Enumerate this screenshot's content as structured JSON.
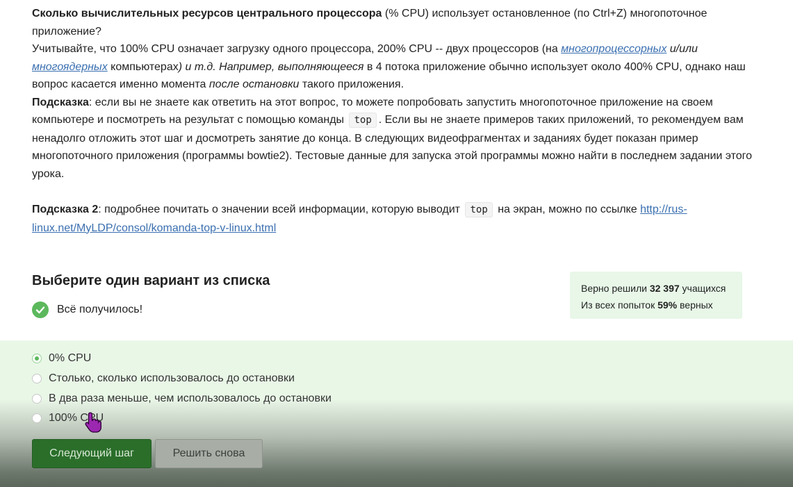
{
  "question": {
    "line1_bold": "Сколько вычислительных ресурсов центрального процессора",
    "line1_rest": " (% CPU) использует остановленное (по Ctrl+Z) многопоточное приложение?",
    "p2_a": "Учитывайте, что 100% CPU означает загрузку одного процессора, 200% CPU -- двух процессоров (на ",
    "p2_link1": "многопроцессорных",
    "p2_b": " и/или ",
    "p2_link2": "многоядерных",
    "p2_c": " компьютерах",
    "p2_d": ") и т.д. Например, ",
    "p2_e": "выполняющееся",
    "p2_f": " в 4 потока приложение обычно использует около 400% CPU, однако наш вопрос касается именно момента ",
    "p2_g": "после остановки",
    "p2_h": " такого приложения.",
    "hint1_label": "Подсказка",
    "hint1_a": ": если вы не знаете как ответить на этот вопрос, то можете попробовать запустить многопоточное приложение на своем компьютере и посмотреть на результат с помощью команды",
    "hint1_cmd": "top",
    "hint1_b": ". Если вы не знаете примеров таких приложений, то рекомендуем вам ненадолго отложить этот шаг и досмотреть занятие до конца. В следующих видеофрагментах и заданиях будет показан пример многопоточного приложения (программы bowtie2). Тестовые данные для запуска этой программы можно найти в последнем задании этого урока.",
    "hint2_label": "Подсказка 2",
    "hint2_a": ": подробнее почитать о значении всей информации, которую выводит",
    "hint2_cmd": "top",
    "hint2_b": "на экран, можно по ссылке ",
    "hint2_link": "http://rus-linux.net/MyLDP/consol/komanda-top-v-linux.html"
  },
  "quiz": {
    "title": "Выберите один вариант из списка",
    "result": "Всё получилось!",
    "stats_line1_prefix": "Верно решили ",
    "stats_solved": "32 397",
    "stats_line1_suffix": " учащихся",
    "stats_line2_prefix": "Из всех попыток ",
    "stats_percent": "59%",
    "stats_line2_suffix": " верных",
    "options": [
      {
        "label": "0% CPU",
        "selected": true
      },
      {
        "label": "Столько, сколько использовалось до остановки",
        "selected": false
      },
      {
        "label": "В два раза меньше, чем использовалось до остановки",
        "selected": false
      },
      {
        "label": "100% CPU",
        "selected": false
      }
    ],
    "next_button": "Следующий шаг",
    "retry_button": "Решить снова"
  },
  "colors": {
    "accent_green": "#5cb85c",
    "link": "#3a6fb0",
    "next_button_bg": "#2a6e2a"
  },
  "icons": {
    "result": "check-circle-icon",
    "cursor": "hand-pointer-icon"
  }
}
